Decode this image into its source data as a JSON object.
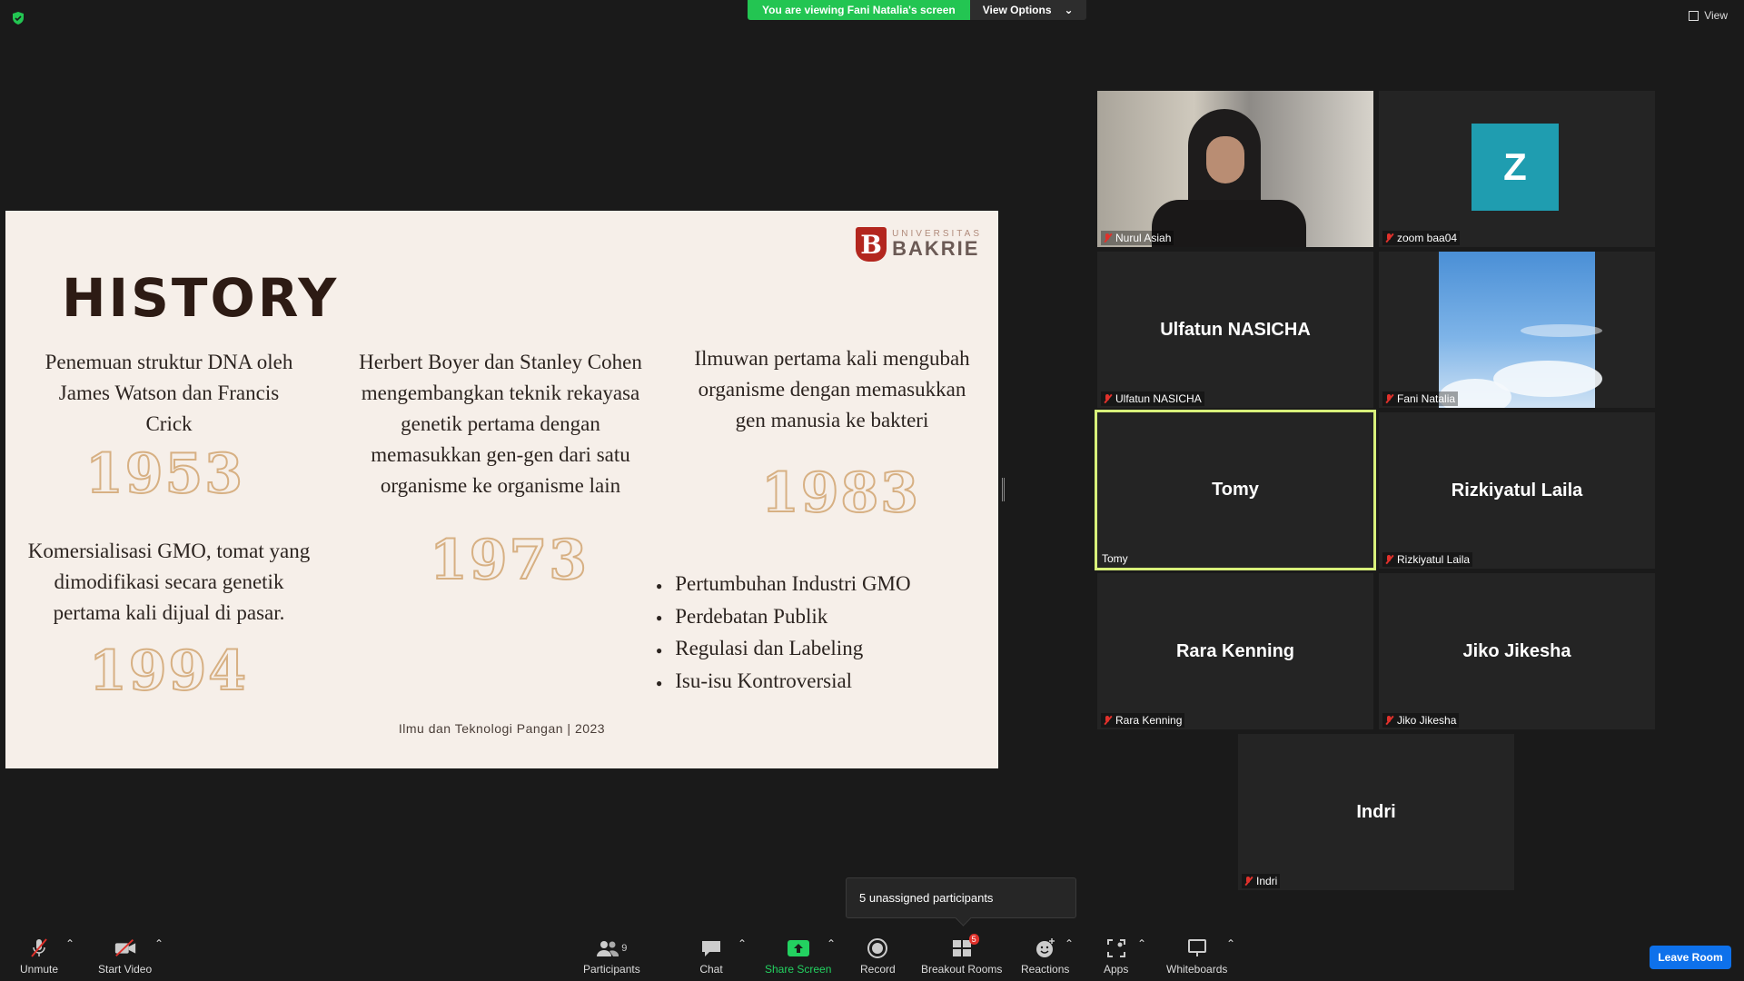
{
  "banner": {
    "viewing": "You are viewing Fani Natalia's screen",
    "view_options": "View Options"
  },
  "view_button": "View",
  "slide": {
    "logo_small": "UNIVERSITAS",
    "logo_big": "BAKRIE",
    "logo_letter": "B",
    "title": "HISTORY",
    "block1": [
      "Penemuan struktur DNA oleh",
      "James Watson dan Francis",
      "Crick"
    ],
    "year1": "1953",
    "block2": [
      "Herbert Boyer dan Stanley Cohen",
      "mengembangkan teknik rekayasa",
      "genetik pertama dengan",
      "memasukkan gen-gen dari satu",
      "organisme ke organisme lain"
    ],
    "year2": "1973",
    "block3": [
      "Ilmuwan pertama kali mengubah",
      "organisme dengan memasukkan",
      "gen manusia ke bakteri"
    ],
    "year3": "1983",
    "block4": [
      "Komersialisasi GMO, tomat yang",
      "dimodifikasi secara genetik",
      "pertama kali dijual di pasar."
    ],
    "year4": "1994",
    "bullets": [
      "Pertumbuhan Industri GMO",
      "Perdebatan Publik",
      "Regulasi dan Labeling",
      "Isu-isu Kontroversial"
    ],
    "footer": "Ilmu dan Teknologi Pangan | 2023"
  },
  "participants": [
    {
      "name": "Nurul Asiah",
      "muted": true,
      "type": "video"
    },
    {
      "name": "zoom baa04",
      "muted": true,
      "type": "avatar",
      "initial": "Z"
    },
    {
      "name": "Ulfatun NASICHA",
      "muted": true,
      "type": "name"
    },
    {
      "name": "Fani Natalia",
      "muted": true,
      "type": "sky"
    },
    {
      "name": "Tomy",
      "muted": false,
      "type": "name",
      "active": true
    },
    {
      "name": "Rizkiyatul Laila",
      "muted": true,
      "type": "name"
    },
    {
      "name": "Rara Kenning",
      "muted": true,
      "type": "name"
    },
    {
      "name": "Jiko Jikesha",
      "muted": true,
      "type": "name"
    },
    {
      "name": "Indri",
      "muted": true,
      "type": "name"
    }
  ],
  "tooltip": "5 unassigned participants",
  "toolbar": {
    "unmute": "Unmute",
    "start_video": "Start Video",
    "participants": "Participants",
    "participants_count": "9",
    "chat": "Chat",
    "share_screen": "Share Screen",
    "record": "Record",
    "breakout_rooms": "Breakout Rooms",
    "breakout_badge": "5",
    "reactions": "Reactions",
    "apps": "Apps",
    "whiteboards": "Whiteboards",
    "leave": "Leave Room"
  },
  "colors": {
    "share_green": "#23c552",
    "leave_blue": "#0e71eb",
    "active_border": "#d8f07a",
    "mute_red": "#e0312b"
  }
}
